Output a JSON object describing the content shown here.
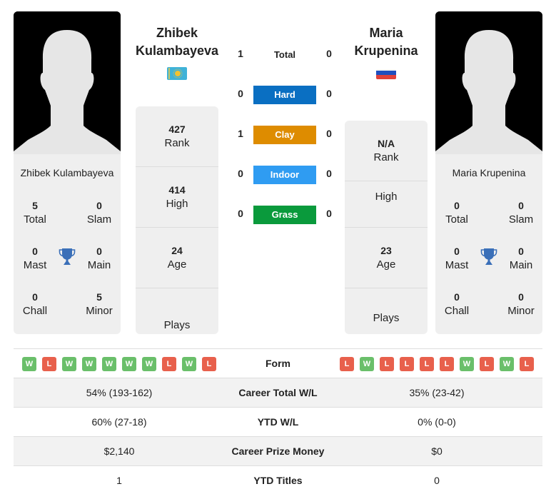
{
  "player_left": {
    "name_line1": "Zhibek",
    "name_line2": "Kulambayeva",
    "full_name": "Zhibek Kulambayeva",
    "flag": "Kazakhstan",
    "titles": {
      "total": "5",
      "total_label": "Total",
      "slam": "0",
      "slam_label": "Slam",
      "mast": "0",
      "mast_label": "Mast",
      "main": "0",
      "main_label": "Main",
      "chall": "0",
      "chall_label": "Chall",
      "minor": "5",
      "minor_label": "Minor"
    },
    "info": {
      "rank": "427",
      "rank_label": "Rank",
      "high": "414",
      "high_label": "High",
      "age": "24",
      "age_label": "Age",
      "plays": "",
      "plays_label": "Plays"
    }
  },
  "player_right": {
    "name_line1": "Maria",
    "name_line2": "Krupenina",
    "full_name": "Maria Krupenina",
    "flag": "Russia",
    "titles": {
      "total": "0",
      "total_label": "Total",
      "slam": "0",
      "slam_label": "Slam",
      "mast": "0",
      "mast_label": "Mast",
      "main": "0",
      "main_label": "Main",
      "chall": "0",
      "chall_label": "Chall",
      "minor": "0",
      "minor_label": "Minor"
    },
    "info": {
      "rank": "N/A",
      "rank_label": "Rank",
      "high": "",
      "high_label": "High",
      "age": "23",
      "age_label": "Age",
      "plays": "",
      "plays_label": "Plays"
    }
  },
  "h2h": {
    "total": {
      "label": "Total",
      "left": "1",
      "right": "0"
    },
    "surfaces": [
      {
        "label": "Hard",
        "left": "0",
        "right": "0",
        "color": "#0a6fc2"
      },
      {
        "label": "Clay",
        "left": "1",
        "right": "0",
        "color": "#de8c00"
      },
      {
        "label": "Indoor",
        "left": "0",
        "right": "0",
        "color": "#2f9cf2"
      },
      {
        "label": "Grass",
        "left": "0",
        "right": "0",
        "color": "#0a9a3c"
      }
    ]
  },
  "comparison": {
    "form": {
      "label": "Form",
      "left": [
        "W",
        "L",
        "W",
        "W",
        "W",
        "W",
        "W",
        "L",
        "W",
        "L"
      ],
      "right": [
        "L",
        "W",
        "L",
        "L",
        "L",
        "L",
        "W",
        "L",
        "W",
        "L"
      ]
    },
    "rows": [
      {
        "label": "Career Total W/L",
        "left": "54% (193-162)",
        "right": "35% (23-42)"
      },
      {
        "label": "YTD W/L",
        "left": "60% (27-18)",
        "right": "0% (0-0)"
      },
      {
        "label": "Career Prize Money",
        "left": "$2,140",
        "right": "$0"
      },
      {
        "label": "YTD Titles",
        "left": "1",
        "right": "0"
      }
    ]
  }
}
